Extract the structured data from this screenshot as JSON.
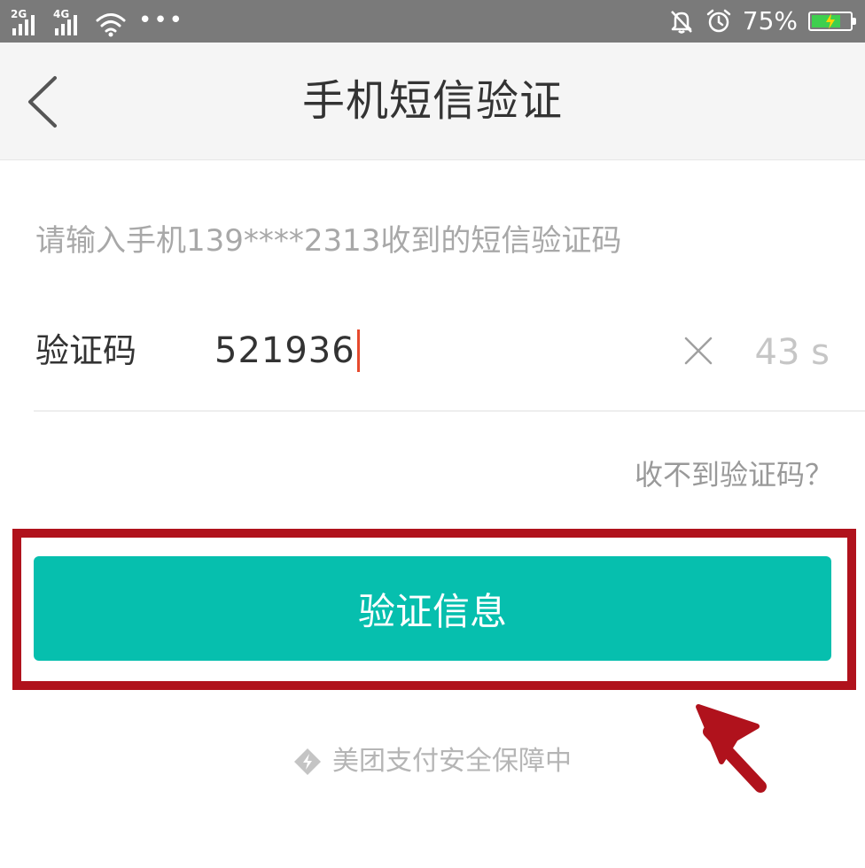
{
  "status_bar": {
    "signal1_label": "2G",
    "signal2_label": "4G",
    "more": "•••",
    "battery_percent": "75%",
    "battery_level": 0.75,
    "battery_color": "#3ecf4e",
    "icons": [
      "signal-2g-icon",
      "signal-4g-icon",
      "wifi-icon",
      "mute-bell-icon",
      "alarm-icon",
      "battery-charging-icon"
    ]
  },
  "nav": {
    "title": "手机短信验证",
    "back_icon": "chevron-left-icon"
  },
  "form": {
    "hint": "请输入手机139****2313收到的短信验证码",
    "code_label": "验证码",
    "code_value": "521936",
    "clear_icon": "close-icon",
    "countdown": "43 s",
    "no_code_link": "收不到验证码？"
  },
  "actions": {
    "verify_label": "验证信息",
    "verify_color": "#06bfae"
  },
  "footer": {
    "security_text": "美团支付安全保障中",
    "security_icon": "shield-bolt-icon"
  },
  "annotation": {
    "highlight_color": "#b0121c",
    "arrow_icon": "arrow-up-left-icon"
  }
}
